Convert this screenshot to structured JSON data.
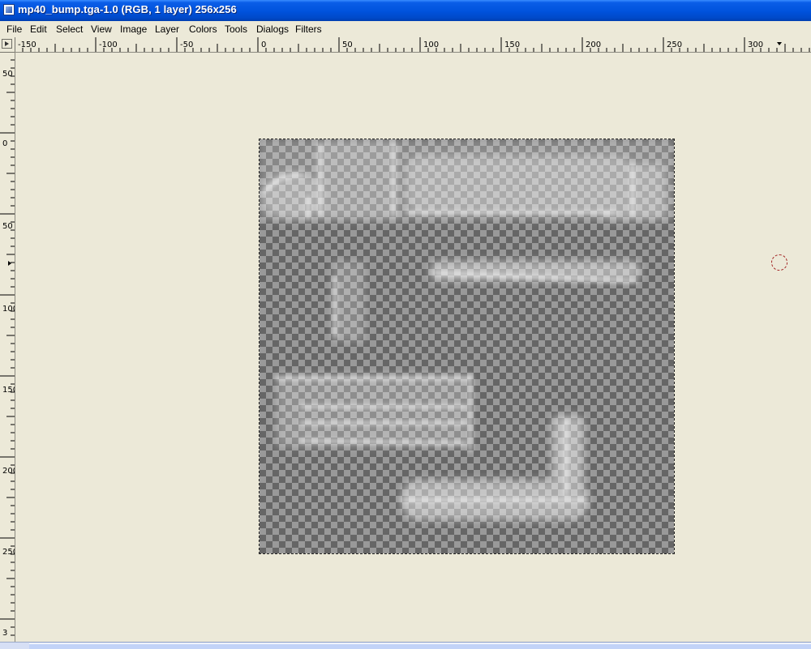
{
  "window": {
    "title": "mp40_bump.tga-1.0 (RGB, 1 layer) 256x256"
  },
  "menu": [
    "File",
    "Edit",
    "Select",
    "View",
    "Image",
    "Layer",
    "Colors",
    "Tools",
    "Dialogs",
    "Filters"
  ],
  "ruler_horizontal_labels": [
    "-150",
    "-100",
    "-50",
    "0",
    "50",
    "100",
    "150",
    "200",
    "250",
    "300"
  ],
  "ruler_vertical_labels": [
    "50",
    "0",
    "50",
    "100",
    "150",
    "200",
    "250",
    "3"
  ],
  "colors": {
    "titlebar": "#0A5EE8",
    "chrome": "#ECE9D8",
    "checker_light": "#999999",
    "checker_dark": "#666666",
    "selection_outline": "#222222"
  },
  "icons": [
    "app-icon",
    "ruler-menu-icon",
    "brush-outline-cursor-icon"
  ]
}
